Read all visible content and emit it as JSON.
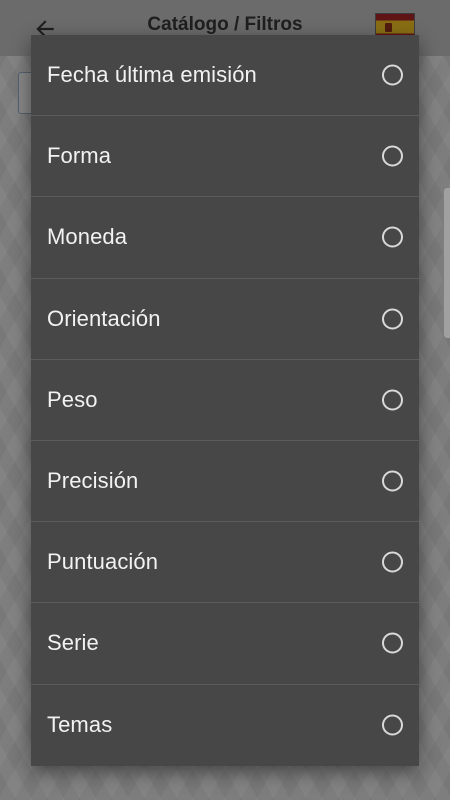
{
  "header": {
    "title": "Catálogo / Filtros",
    "back_icon": "arrow-left-icon",
    "flag_icon": "spain-flag-icon"
  },
  "filter_dialog": {
    "options": [
      {
        "label": "Fecha última emisión",
        "selected": false
      },
      {
        "label": "Forma",
        "selected": false
      },
      {
        "label": "Moneda",
        "selected": false
      },
      {
        "label": "Orientación",
        "selected": false
      },
      {
        "label": "Peso",
        "selected": false
      },
      {
        "label": "Precisión",
        "selected": false
      },
      {
        "label": "Puntuación",
        "selected": false
      },
      {
        "label": "Serie",
        "selected": false
      },
      {
        "label": "Temas",
        "selected": false
      }
    ]
  },
  "colors": {
    "dialog_background": "#474747",
    "divider": "#5c5c5c",
    "text": "#f2f2f2",
    "radio": "#d9d9d9"
  }
}
